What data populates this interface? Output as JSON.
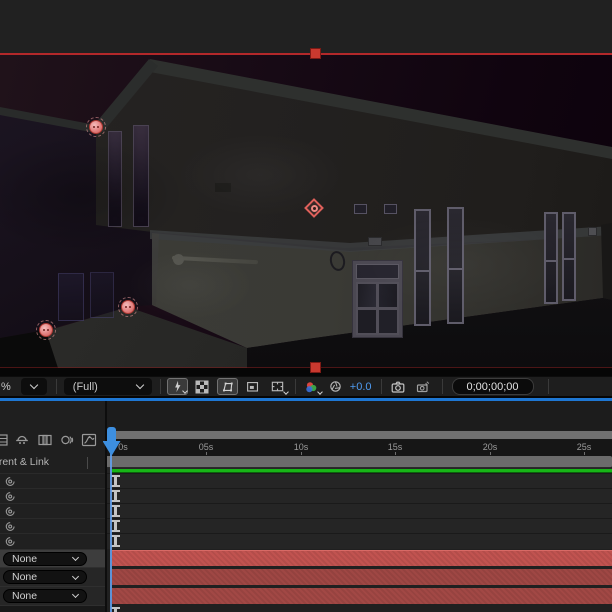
{
  "viewer": {
    "toolbar": {
      "zoom_fragment": "%",
      "resolution_value": "(Full)",
      "exposure_value": "+0.0",
      "timecode": "0;00;00;00",
      "icons": [
        "fast-previews-icon",
        "transparency-grid-icon",
        "mask-path-visibility-icon",
        "region-of-interest-icon",
        "grid-guides-icon",
        "channels-icon",
        "exposure-icon",
        "snapshot-icon",
        "show-snapshot-icon"
      ]
    },
    "selection": {
      "outline_color": "#b3282a",
      "handle_color": "#c9392f",
      "pin_color": "#e3807f",
      "effect_point_color": "#e0605b"
    }
  },
  "timeline": {
    "toolbar_icons": [
      "composition-icon",
      "shy-icon",
      "frame-blending-icon",
      "motion-blur-icon",
      "graph-editor-icon"
    ],
    "header": {
      "parent_link_label": "Parent & Link"
    },
    "ruler_labels": [
      "0s",
      "05s",
      "10s",
      "15s",
      "20s",
      "25s"
    ],
    "property_row_count": 5,
    "property_row_icon": "pick-whip-icon",
    "layers": [
      {
        "parent_label": "None",
        "selected": true,
        "bar_color": "#c15350"
      },
      {
        "parent_label": "None",
        "selected": false,
        "bar_color": "#9f4744"
      },
      {
        "parent_label": "None",
        "selected": false,
        "bar_color": "#a24845"
      }
    ],
    "colors": {
      "accent_blue": "#1e77d3",
      "playhead_blue": "#3d8fe0",
      "green_bar": "#17b517",
      "work_area_gray": "#6b6b6b"
    }
  }
}
